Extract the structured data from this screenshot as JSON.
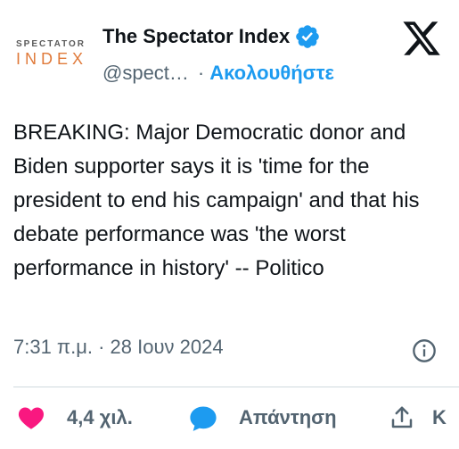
{
  "author": {
    "avatar_line1": "SPECTATOR",
    "avatar_line2": "INDEX",
    "display_name": "The Spectator Index",
    "handle": "@spect…",
    "separator": "·",
    "follow_label": "Ακολουθήστε"
  },
  "tweet": {
    "text": "BREAKING: Major Democratic donor and Biden supporter says it is 'time for the president to end his campaign' and that his debate performance was 'the worst performance in history' -- Politico",
    "timestamp": "7:31 π.μ. · 28 Ιουν 2024"
  },
  "actions": {
    "like_count": "4,4 χιλ.",
    "reply_label": "Απάντηση",
    "share_label": "Κ"
  },
  "colors": {
    "accent": "#1d9bf0",
    "like": "#f91880",
    "text": "#0f1419",
    "muted": "#536471",
    "avatar_orange": "#e07a3a"
  },
  "icons": {
    "verified": "verified-badge-icon",
    "x_logo": "x-logo-icon",
    "info": "info-icon",
    "like": "heart-icon",
    "reply": "speech-bubble-icon",
    "share": "share-upload-icon"
  }
}
